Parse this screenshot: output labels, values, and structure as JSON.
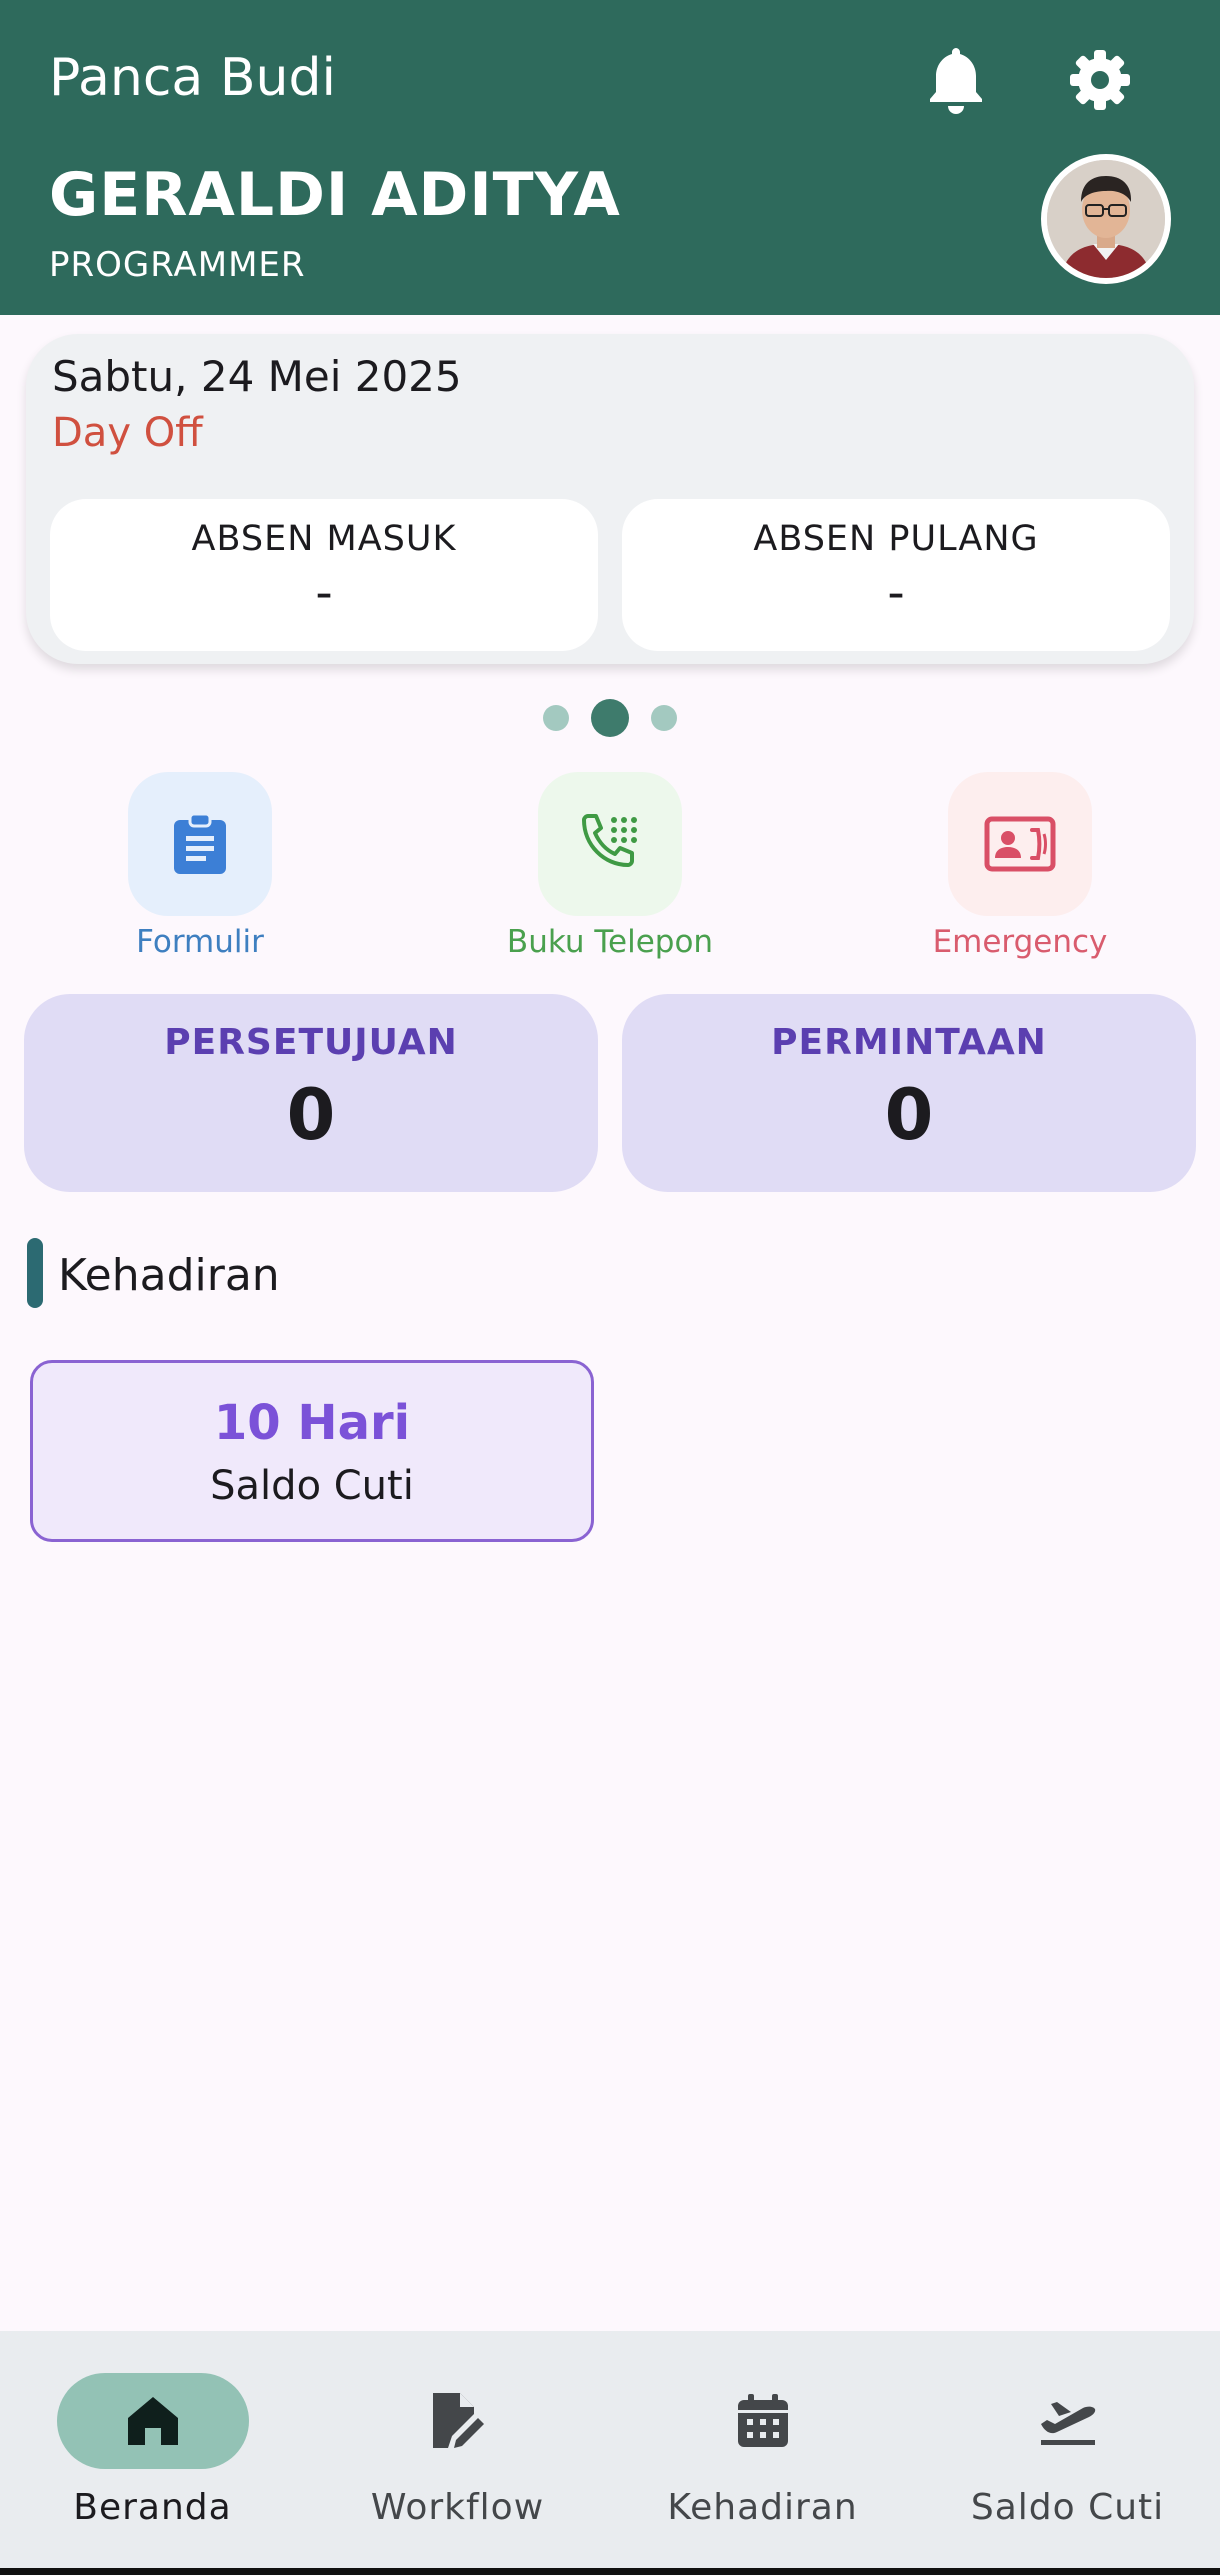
{
  "header": {
    "app_title": "Panca Budi",
    "user_name": "GERALDI ADITYA",
    "user_role": "PROGRAMMER"
  },
  "attendance": {
    "date": "Sabtu, 24 Mei 2025",
    "status": "Day Off",
    "check_in_label": "ABSEN MASUK",
    "check_in_value": "-",
    "check_out_label": "ABSEN PULANG",
    "check_out_value": "-"
  },
  "shortcuts": [
    {
      "label": "Formulir",
      "icon": "clipboard-icon"
    },
    {
      "label": "Buku Telepon",
      "icon": "phone-dialpad-icon"
    },
    {
      "label": "Emergency",
      "icon": "contact-phone-icon"
    }
  ],
  "stats": {
    "approval_label": "PERSETUJUAN",
    "approval_value": "0",
    "request_label": "PERMINTAAN",
    "request_value": "0"
  },
  "section": {
    "title": "Kehadiran"
  },
  "leave": {
    "value": "10 Hari",
    "label": "Saldo Cuti"
  },
  "nav": [
    {
      "label": "Beranda",
      "icon": "home-icon",
      "active": true
    },
    {
      "label": "Workflow",
      "icon": "document-edit-icon",
      "active": false
    },
    {
      "label": "Kehadiran",
      "icon": "calendar-icon",
      "active": false
    },
    {
      "label": "Saldo Cuti",
      "icon": "plane-departure-icon",
      "active": false
    }
  ],
  "colors": {
    "header_bg": "#2e6a5c",
    "status_red": "#d0503f",
    "stat_bg": "#e0dcf5",
    "accent_purple": "#7b52d8",
    "nav_active": "#93c2b5"
  }
}
